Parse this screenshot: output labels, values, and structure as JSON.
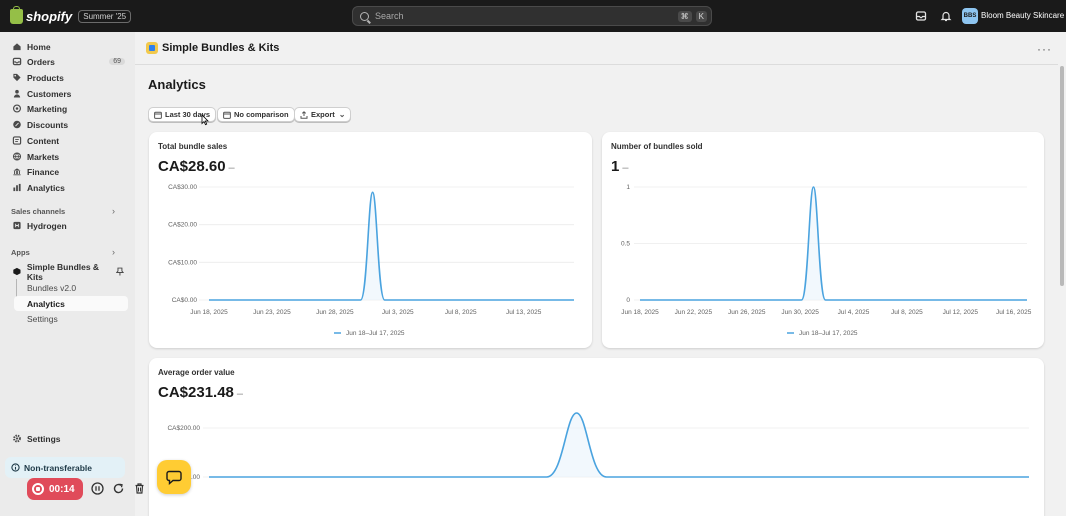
{
  "topbar": {
    "logo_text": "shopify",
    "edition": "Summer '25",
    "search_placeholder": "Search",
    "shortcut_cmd": "⌘",
    "shortcut_key": "K",
    "store_initials": "BBS",
    "store_name": "Bloom Beauty Skincare"
  },
  "sidebar": {
    "items": [
      {
        "label": "Home",
        "icon": "home-icon"
      },
      {
        "label": "Orders",
        "icon": "orders-icon",
        "count": "69"
      },
      {
        "label": "Products",
        "icon": "tag-icon"
      },
      {
        "label": "Customers",
        "icon": "person-icon"
      },
      {
        "label": "Marketing",
        "icon": "target-icon"
      },
      {
        "label": "Discounts",
        "icon": "discount-icon"
      },
      {
        "label": "Content",
        "icon": "content-icon"
      },
      {
        "label": "Markets",
        "icon": "globe-icon"
      },
      {
        "label": "Finance",
        "icon": "bank-icon"
      },
      {
        "label": "Analytics",
        "icon": "chart-bar-icon"
      }
    ],
    "sales_channels_title": "Sales channels",
    "hydrogen_label": "Hydrogen",
    "apps_title": "Apps",
    "app_name": "Simple Bundles & Kits",
    "app_sub_items": [
      {
        "label": "Bundles v2.0"
      },
      {
        "label": "Analytics"
      },
      {
        "label": "Settings"
      }
    ],
    "settings_label": "Settings",
    "nontransferable_label": "Non-transferable"
  },
  "recorder": {
    "time": "00:14"
  },
  "header": {
    "app_title": "Simple Bundles & Kits"
  },
  "page": {
    "title": "Analytics"
  },
  "toolbar": {
    "date_range": "Last 30 days",
    "comparison": "No comparison",
    "export": "Export"
  },
  "cards": {
    "total_sales": {
      "label": "Total bundle sales",
      "value": "CA$28.60",
      "delta": "–",
      "legend": "Jun 18–Jul 17, 2025"
    },
    "bundles_sold": {
      "label": "Number of bundles sold",
      "value": "1",
      "delta": "–",
      "legend": "Jun 18–Jul 17, 2025"
    },
    "avg_order": {
      "label": "Average order value",
      "value": "CA$231.48",
      "delta": "–"
    }
  },
  "colors": {
    "line": "#4aa3df",
    "accent_fab": "#ffcc33",
    "recorder": "#e04b5a"
  },
  "chart_data": [
    {
      "type": "line",
      "title": "Total bundle sales",
      "yticks": [
        "CA$30.00",
        "CA$20.00",
        "CA$10.00",
        "CA$0.00"
      ],
      "ylim": [
        0,
        30
      ],
      "xticks": [
        "Jun 18, 2025",
        "Jun 23, 2025",
        "Jun 28, 2025",
        "Jul 3, 2025",
        "Jul 8, 2025",
        "Jul 13, 2025"
      ],
      "x_range": [
        "Jun 18, 2025",
        "Jul 17, 2025"
      ],
      "series": [
        {
          "name": "Jun 18–Jul 17, 2025",
          "points": [
            {
              "x": "Jul 1, 2025",
              "y": 28.6
            }
          ]
        }
      ],
      "grid": true
    },
    {
      "type": "line",
      "title": "Number of bundles sold",
      "yticks": [
        "1",
        "0.5",
        "0"
      ],
      "ylim": [
        0,
        1
      ],
      "xticks": [
        "Jun 18, 2025",
        "Jun 22, 2025",
        "Jun 26, 2025",
        "Jun 30, 2025",
        "Jul 4, 2025",
        "Jul 8, 2025",
        "Jul 12, 2025",
        "Jul 16, 2025"
      ],
      "x_range": [
        "Jun 18, 2025",
        "Jul 17, 2025"
      ],
      "series": [
        {
          "name": "Jun 18–Jul 17, 2025",
          "points": [
            {
              "x": "Jul 1, 2025",
              "y": 1
            }
          ]
        }
      ],
      "grid": true
    },
    {
      "type": "line",
      "title": "Average order value",
      "yticks": [
        "CA$200.00",
        "CA$100.00"
      ],
      "series": [
        {
          "points": [
            {
              "x": "Jul 1, 2025",
              "y": 231.48
            }
          ]
        }
      ],
      "grid": true
    }
  ]
}
